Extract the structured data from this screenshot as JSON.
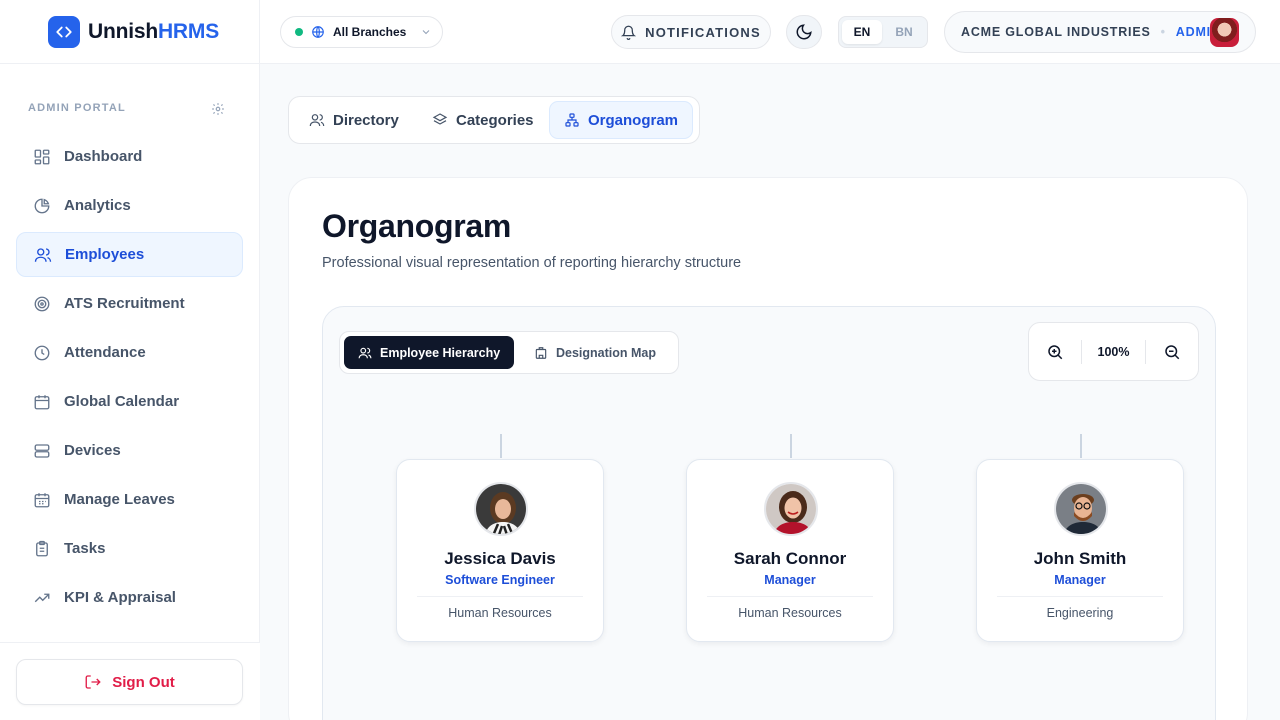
{
  "app": {
    "logo_text_main": "Unnish",
    "logo_text_accent": "HRMS"
  },
  "sidebar": {
    "section_label": "ADMIN PORTAL",
    "items": [
      {
        "label": "Dashboard",
        "icon": "dashboard-icon"
      },
      {
        "label": "Analytics",
        "icon": "analytics-icon"
      },
      {
        "label": "Employees",
        "icon": "employees-icon",
        "active": true
      },
      {
        "label": "ATS Recruitment",
        "icon": "target-icon"
      },
      {
        "label": "Attendance",
        "icon": "clock-icon"
      },
      {
        "label": "Global Calendar",
        "icon": "calendar-icon"
      },
      {
        "label": "Devices",
        "icon": "server-icon"
      },
      {
        "label": "Manage Leaves",
        "icon": "calendar-days-icon"
      },
      {
        "label": "Tasks",
        "icon": "clipboard-icon"
      },
      {
        "label": "KPI & Appraisal",
        "icon": "trending-icon"
      }
    ],
    "signout_label": "Sign Out"
  },
  "topbar": {
    "branch_label": "All Branches",
    "notifications_label": "NOTIFICATIONS",
    "lang_en": "EN",
    "lang_bn": "BN",
    "company": "ACME GLOBAL INDUSTRIES",
    "role": "ADMIN"
  },
  "tabs": [
    {
      "label": "Directory"
    },
    {
      "label": "Categories"
    },
    {
      "label": "Organogram",
      "active": true
    }
  ],
  "page": {
    "title": "Organogram",
    "subtitle": "Professional visual representation of reporting hierarchy structure"
  },
  "view_toggle": {
    "hierarchy_label": "Employee Hierarchy",
    "designation_label": "Designation Map"
  },
  "zoom": {
    "value": "100%"
  },
  "employees": [
    {
      "name": "Jessica Davis",
      "role": "Software Engineer",
      "department": "Human Resources"
    },
    {
      "name": "Sarah Connor",
      "role": "Manager",
      "department": "Human Resources"
    },
    {
      "name": "John Smith",
      "role": "Manager",
      "department": "Engineering"
    }
  ],
  "colors": {
    "brand": "#2563eb",
    "active_bg": "#eff6ff",
    "signout": "#e11d48",
    "status_online": "#10b981"
  }
}
